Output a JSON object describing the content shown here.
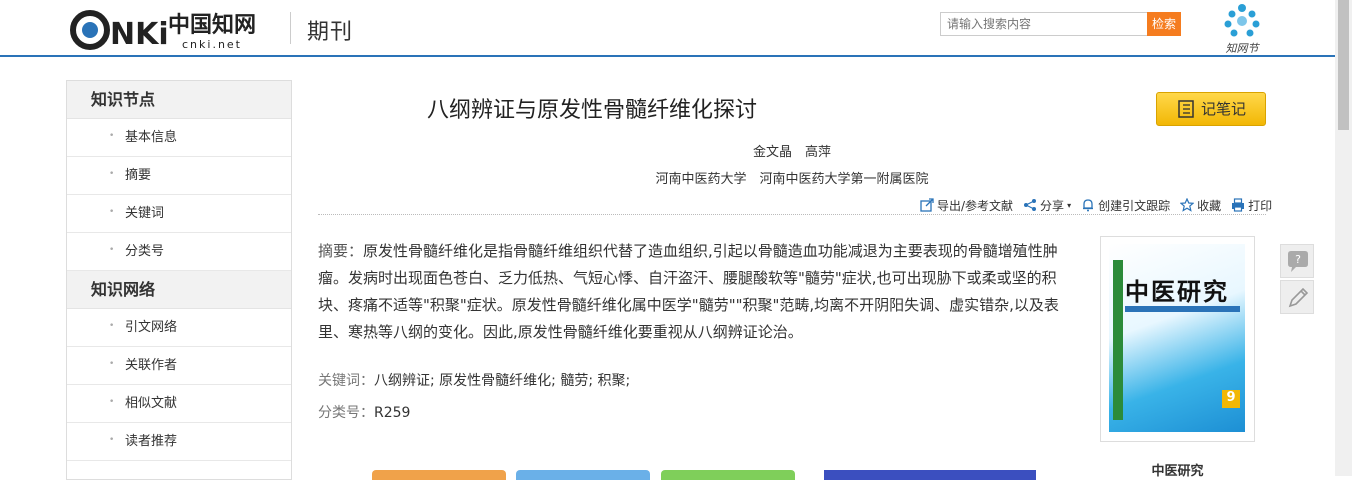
{
  "header": {
    "logo_text": "CNKi",
    "logo_cn": "中国知网",
    "logo_url": "cnki.net",
    "section_title": "期刊",
    "search_placeholder": "请输入搜索内容",
    "search_button": "检索",
    "app_logo_label": "知网节"
  },
  "sidebar": {
    "groups": [
      {
        "title": "知识节点",
        "items": [
          "基本信息",
          "摘要",
          "关键词",
          "分类号"
        ]
      },
      {
        "title": "知识网络",
        "items": [
          "引文网络",
          "关联作者",
          "相似文献",
          "读者推荐"
        ]
      }
    ]
  },
  "article": {
    "title": "八纲辨证与原发性骨髓纤维化探讨",
    "note_button": "记笔记",
    "authors": "金文晶　高萍",
    "affiliations": "河南中医药大学　河南中医药大学第一附属医院",
    "actions": {
      "export": "导出/参考文献",
      "share": "分享",
      "track": "创建引文跟踪",
      "favorite": "收藏",
      "print": "打印"
    },
    "abstract_label": "摘要：",
    "abstract_text": "原发性骨髓纤维化是指骨髓纤维组织代替了造血组织,引起以骨髓造血功能减退为主要表现的骨髓增殖性肿瘤。发病时出现面色苍白、乏力低热、气短心悸、自汗盗汗、腰腿酸软等\"髓劳\"症状,也可出现胁下或柔或坚的积块、疼痛不适等\"积聚\"症状。原发性骨髓纤维化属中医学\"髓劳\"\"积聚\"范畴,均离不开阴阳失调、虚实错杂,以及表里、寒热等八纲的变化。因此,原发性骨髓纤维化要重视从八纲辨证论治。",
    "keywords_label": "关键词：",
    "keywords": "八纲辨证; 原发性骨髓纤维化; 髓劳; 积聚;",
    "class_label": "分类号：",
    "class_code": "R259"
  },
  "journal": {
    "cover_title": "中医研究",
    "cover_issue": "9",
    "name": "中医研究"
  },
  "colors": {
    "accent_blue": "#2a73b8",
    "search_orange": "#f57c1f",
    "note_yellow": "#f2b705"
  }
}
